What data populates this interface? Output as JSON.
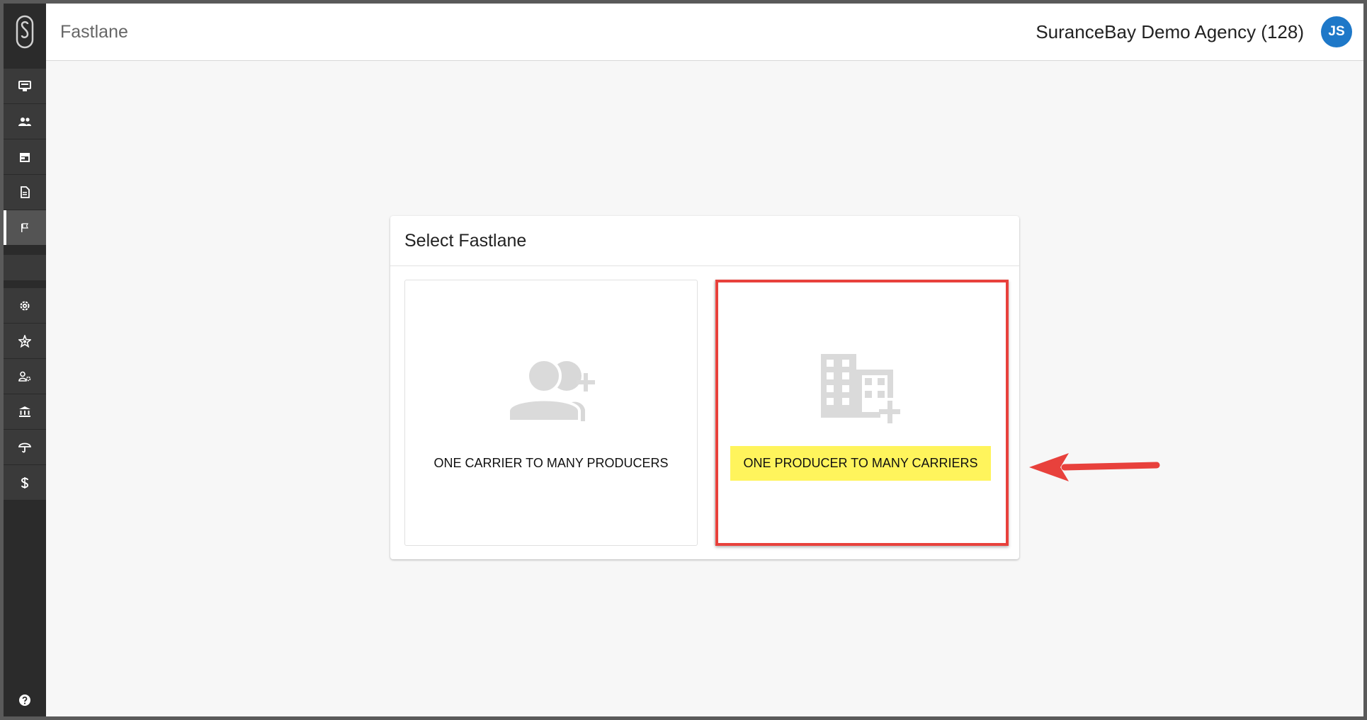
{
  "header": {
    "app_title": "Fastlane",
    "agency_name": "SuranceBay Demo Agency (128)",
    "avatar_initials": "JS"
  },
  "sidebar": {
    "items": [
      {
        "icon": "monitor-icon"
      },
      {
        "icon": "people-icon"
      },
      {
        "icon": "store-icon"
      },
      {
        "icon": "document-icon"
      },
      {
        "icon": "flag-icon",
        "active": true
      },
      {
        "icon": "gear-icon"
      },
      {
        "icon": "star-badge-icon"
      },
      {
        "icon": "user-settings-icon"
      },
      {
        "icon": "bank-icon"
      },
      {
        "icon": "umbrella-icon"
      },
      {
        "icon": "dollar-icon"
      }
    ],
    "help_icon": "help-icon"
  },
  "dialog": {
    "title": "Select Fastlane",
    "options": [
      {
        "label": "ONE CARRIER TO MANY PRODUCERS",
        "icon": "group-add-icon"
      },
      {
        "label": "ONE PRODUCER TO MANY CARRIERS",
        "icon": "building-add-icon",
        "highlighted": true
      }
    ]
  },
  "colors": {
    "sidebar_bg": "#2b2b2b",
    "avatar_bg": "#1e78c8",
    "annotation_red": "#e8413c",
    "highlight_yellow": "#fff45c"
  }
}
